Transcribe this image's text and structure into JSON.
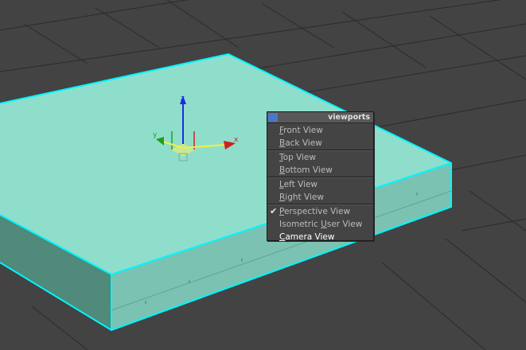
{
  "viewport": {
    "background": "#434343",
    "grid_color": "#2b2b2b",
    "object_color": "#8fd6c6",
    "selection_color": "#00ffff"
  },
  "gizmo": {
    "axes": [
      {
        "name": "z",
        "label": "z",
        "color": "#1e2be0"
      },
      {
        "name": "x",
        "label": "x",
        "color": "#d02020"
      },
      {
        "name": "y",
        "label": "y",
        "color": "#20a020"
      }
    ]
  },
  "quad_menu": {
    "title": "viewports",
    "title_swatch_color": "#4a78c8",
    "groups": [
      [
        {
          "key": "F",
          "rest": "ront View",
          "checked": false,
          "highlight": false
        },
        {
          "key": "B",
          "rest": "ack View",
          "checked": false,
          "highlight": false
        }
      ],
      [
        {
          "key": "T",
          "rest": "op View",
          "checked": false,
          "highlight": false
        },
        {
          "key": "B",
          "rest": "ottom View",
          "checked": false,
          "highlight": false
        }
      ],
      [
        {
          "key": "L",
          "rest": "eft View",
          "checked": false,
          "highlight": false
        },
        {
          "key": "R",
          "rest": "ight View",
          "checked": false,
          "highlight": false
        }
      ],
      [
        {
          "key": "P",
          "rest": "erspective View",
          "checked": true,
          "highlight": false
        },
        {
          "pre": "Isometric ",
          "key": "U",
          "rest": "ser View",
          "checked": false,
          "highlight": false
        },
        {
          "key": "C",
          "rest": "amera View",
          "checked": false,
          "highlight": true
        }
      ]
    ],
    "check_glyph": "✔"
  }
}
